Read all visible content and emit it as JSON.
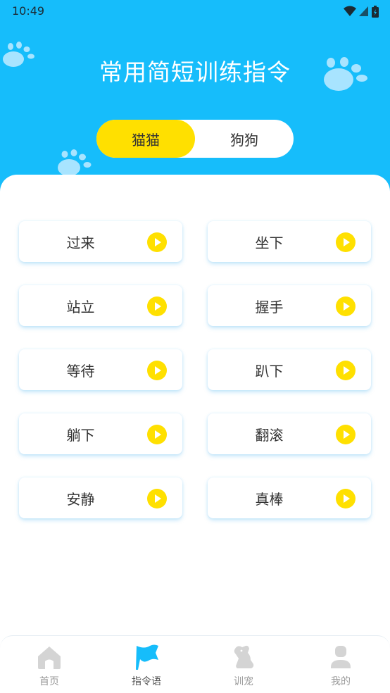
{
  "status_bar": {
    "time": "10:49"
  },
  "header": {
    "title": "常用简短训练指令"
  },
  "toggle": {
    "left_label": "猫猫",
    "right_label": "狗狗",
    "active": "left"
  },
  "commands": [
    {
      "label": "过来"
    },
    {
      "label": "坐下"
    },
    {
      "label": "站立"
    },
    {
      "label": "握手"
    },
    {
      "label": "等待"
    },
    {
      "label": "趴下"
    },
    {
      "label": "躺下"
    },
    {
      "label": "翻滚"
    },
    {
      "label": "安静"
    },
    {
      "label": "真棒"
    }
  ],
  "tabbar": {
    "items": [
      {
        "label": "首页",
        "icon": "home-icon"
      },
      {
        "label": "指令语",
        "icon": "flag-icon"
      },
      {
        "label": "训宠",
        "icon": "dog-icon"
      },
      {
        "label": "我的",
        "icon": "user-icon"
      }
    ],
    "active_index": 1
  },
  "colors": {
    "header_blue": "#16bdfb",
    "accent_yellow": "#ffe000"
  }
}
